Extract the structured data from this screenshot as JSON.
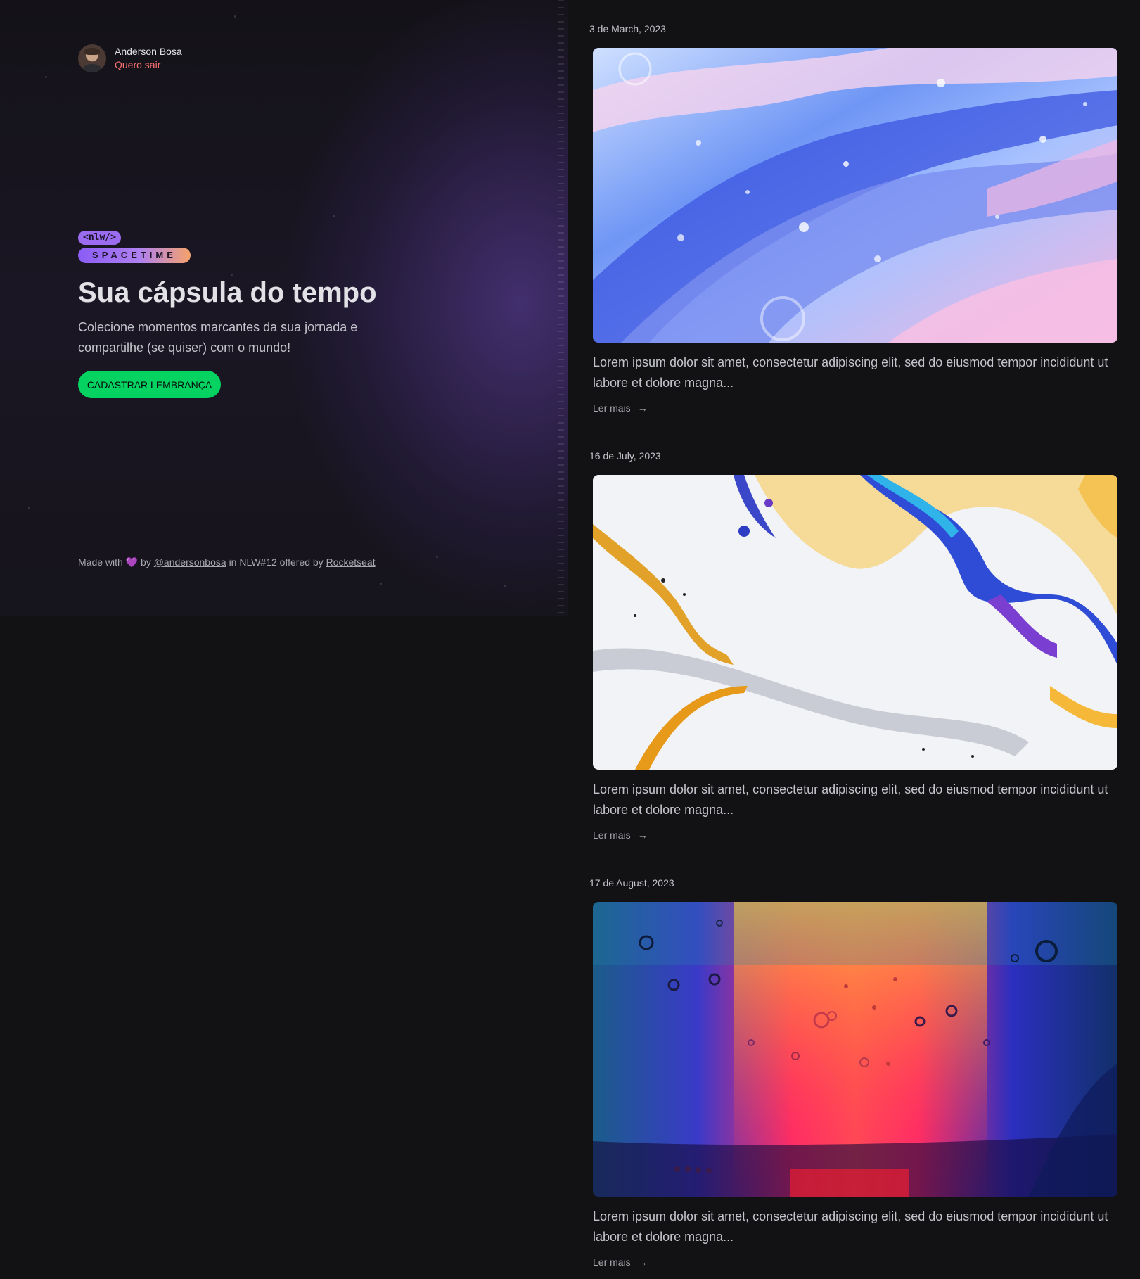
{
  "profile": {
    "name": "Anderson Bosa",
    "logout_label": "Quero sair"
  },
  "brand": {
    "tag": "<nlw/>",
    "word": "SPACETIME"
  },
  "hero": {
    "title": "Sua cápsula do tempo",
    "subtitle": "Colecione momentos marcantes da sua jornada e compartilhe (se quiser) com o mundo!",
    "cta_label": "CADASTRAR LEMBRANÇA"
  },
  "footer": {
    "made_with": "Made with",
    "heart": "💜",
    "by": "by",
    "author_link": "@andersonbosa",
    "in_text": "in NLW#12 offered by",
    "sponsor_link": "Rocketseat"
  },
  "memories": [
    {
      "date": "3 de March, 2023",
      "excerpt": "Lorem ipsum dolor sit amet, consectetur adipiscing elit, sed do eiusmod tempor incididunt ut labore et dolore magna...",
      "read_more": "Ler mais",
      "arrow": "→"
    },
    {
      "date": "16 de July, 2023",
      "excerpt": "Lorem ipsum dolor sit amet, consectetur adipiscing elit, sed do eiusmod tempor incididunt ut labore et dolore magna...",
      "read_more": "Ler mais",
      "arrow": "→"
    },
    {
      "date": "17 de August, 2023",
      "excerpt": "Lorem ipsum dolor sit amet, consectetur adipiscing elit, sed do eiusmod tempor incididunt ut labore et dolore magna...",
      "read_more": "Ler mais",
      "arrow": "→"
    }
  ],
  "colors": {
    "accent_green": "#04d361",
    "logout_red": "#f87171",
    "background": "#121215",
    "brand_purple": "#9b6cf0"
  }
}
